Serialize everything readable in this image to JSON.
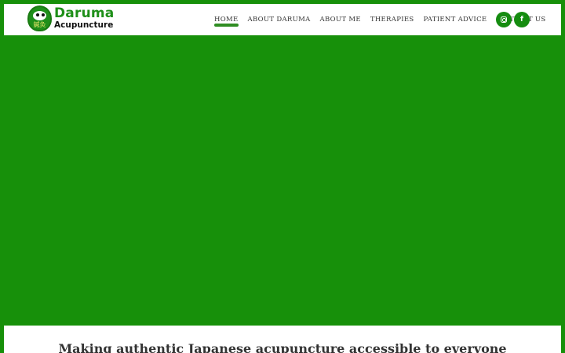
{
  "logo": {
    "line1": "Daruma",
    "line2": "Acupuncture",
    "kanji": "鍼灸"
  },
  "nav": {
    "items": [
      {
        "label": "HOME",
        "active": true
      },
      {
        "label": "ABOUT DARUMA",
        "active": false
      },
      {
        "label": "ABOUT ME",
        "active": false
      },
      {
        "label": "THERAPIES",
        "active": false
      },
      {
        "label": "PATIENT ADVICE",
        "active": false
      },
      {
        "label": "CONTACT US",
        "active": false
      }
    ]
  },
  "social": {
    "instagram_icon": "instagram-icon",
    "facebook_icon": "facebook-icon",
    "facebook_glyph": "f"
  },
  "content": {
    "tagline": "Making authentic Japanese acupuncture accessible to everyone"
  },
  "colors": {
    "brand_green": "#17900a",
    "accent_green": "#1e8f18",
    "white": "#ffffff",
    "text": "#333333"
  }
}
